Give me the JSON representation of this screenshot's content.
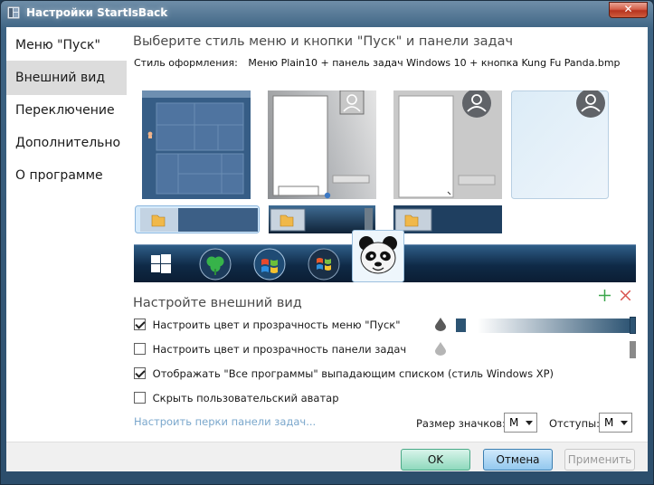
{
  "window": {
    "title": "Настройки StartIsBack",
    "close_glyph": "✕"
  },
  "nav": {
    "items": [
      {
        "label": "Меню \"Пуск\"",
        "active": false
      },
      {
        "label": "Внешний вид",
        "active": true
      },
      {
        "label": "Переключение",
        "active": false
      },
      {
        "label": "Дополнительно",
        "active": false
      },
      {
        "label": "О программе",
        "active": false
      }
    ]
  },
  "main": {
    "heading": "Выберите стиль меню и кнопки \"Пуск\" и панели задач",
    "style_label": "Стиль оформления:",
    "style_value": "Меню Plain10 + панель задач Windows 10 + кнопка Kung Fu Panda.bmp",
    "menu_styles": [
      "windows-10",
      "windows-7-gradient",
      "windows-7-plain",
      "windows-8-glass"
    ],
    "selected_menu_style": 0,
    "taskbar_styles": [
      "light",
      "dark-gradient",
      "dark"
    ],
    "start_buttons": [
      "windows-10-logo",
      "clover-orb",
      "windows-7-orb",
      "windows-vista-orb",
      "kung-fu-panda"
    ],
    "selected_start_button": 4
  },
  "appearance": {
    "heading": "Настройте внешний вид",
    "add_icon": "plus-icon",
    "remove_icon": "x-icon",
    "options": [
      {
        "label": "Настроить цвет и прозрачность меню \"Пуск\"",
        "checked": true
      },
      {
        "label": "Настроить цвет и прозрачность панели задач",
        "checked": false
      },
      {
        "label": "Отображать \"Все программы\" выпадающим списком (стиль Windows XP)",
        "checked": true
      },
      {
        "label": "Скрыть пользовательский аватар",
        "checked": false
      }
    ],
    "menu_opacity_color": "#2d5473",
    "perks_link": "Настроить перки панели задач...",
    "icon_size_label": "Размер значков:",
    "icon_size_value": "M",
    "spacing_label": "Отступы:",
    "spacing_value": "M"
  },
  "footer": {
    "ok_label": "OK",
    "cancel_label": "Отмена",
    "apply_label": "Применить"
  },
  "colors": {
    "accent_ok": "#8fd9bd",
    "accent_cancel": "#93c8ee",
    "link": "#7aa7cc",
    "taskbar_blue": "#2d5473"
  }
}
